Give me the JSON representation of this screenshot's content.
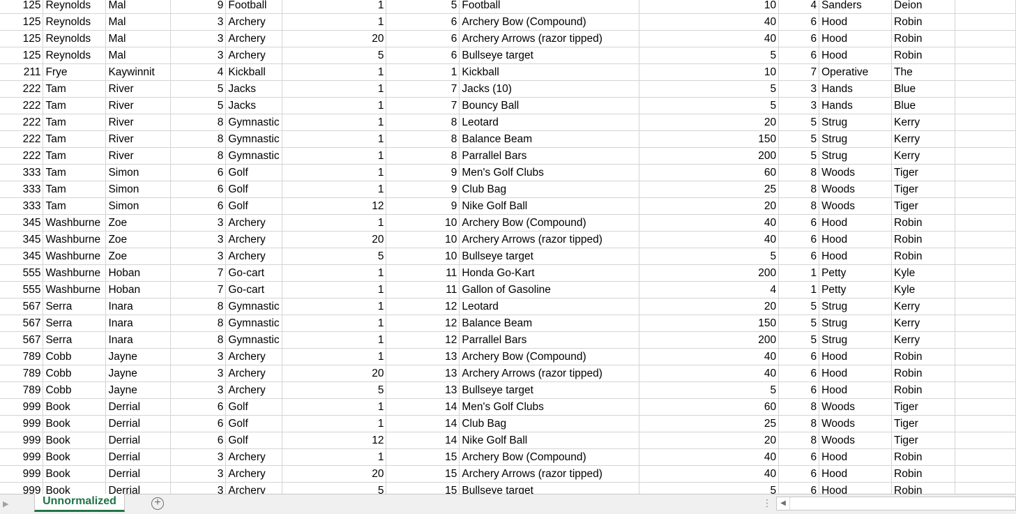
{
  "sheet_tab": "Unnormalized",
  "rows": [
    [
      "125",
      "Reynolds",
      "Mal",
      "9",
      "Football",
      "1",
      "5",
      "Football",
      "10",
      "4",
      "Sanders",
      "Deion"
    ],
    [
      "125",
      "Reynolds",
      "Mal",
      "3",
      "Archery",
      "1",
      "6",
      "Archery Bow (Compound)",
      "40",
      "6",
      "Hood",
      "Robin"
    ],
    [
      "125",
      "Reynolds",
      "Mal",
      "3",
      "Archery",
      "20",
      "6",
      "Archery Arrows (razor tipped)",
      "40",
      "6",
      "Hood",
      "Robin"
    ],
    [
      "125",
      "Reynolds",
      "Mal",
      "3",
      "Archery",
      "5",
      "6",
      "Bullseye target",
      "5",
      "6",
      "Hood",
      "Robin"
    ],
    [
      "211",
      "Frye",
      "Kaywinnit",
      "4",
      "Kickball",
      "1",
      "1",
      "Kickball",
      "10",
      "7",
      "Operative",
      "The"
    ],
    [
      "222",
      "Tam",
      "River",
      "5",
      "Jacks",
      "1",
      "7",
      "Jacks (10)",
      "5",
      "3",
      "Hands",
      "Blue"
    ],
    [
      "222",
      "Tam",
      "River",
      "5",
      "Jacks",
      "1",
      "7",
      "Bouncy Ball",
      "5",
      "3",
      "Hands",
      "Blue"
    ],
    [
      "222",
      "Tam",
      "River",
      "8",
      "Gymnastic",
      "1",
      "8",
      "Leotard",
      "20",
      "5",
      "Strug",
      "Kerry"
    ],
    [
      "222",
      "Tam",
      "River",
      "8",
      "Gymnastic",
      "1",
      "8",
      "Balance Beam",
      "150",
      "5",
      "Strug",
      "Kerry"
    ],
    [
      "222",
      "Tam",
      "River",
      "8",
      "Gymnastic",
      "1",
      "8",
      "Parrallel Bars",
      "200",
      "5",
      "Strug",
      "Kerry"
    ],
    [
      "333",
      "Tam",
      "Simon",
      "6",
      "Golf",
      "1",
      "9",
      "Men's Golf Clubs",
      "60",
      "8",
      "Woods",
      "Tiger"
    ],
    [
      "333",
      "Tam",
      "Simon",
      "6",
      "Golf",
      "1",
      "9",
      "Club Bag",
      "25",
      "8",
      "Woods",
      "Tiger"
    ],
    [
      "333",
      "Tam",
      "Simon",
      "6",
      "Golf",
      "12",
      "9",
      "Nike Golf Ball",
      "20",
      "8",
      "Woods",
      "Tiger"
    ],
    [
      "345",
      "Washburne",
      "Zoe",
      "3",
      "Archery",
      "1",
      "10",
      "Archery Bow (Compound)",
      "40",
      "6",
      "Hood",
      "Robin"
    ],
    [
      "345",
      "Washburne",
      "Zoe",
      "3",
      "Archery",
      "20",
      "10",
      "Archery Arrows (razor tipped)",
      "40",
      "6",
      "Hood",
      "Robin"
    ],
    [
      "345",
      "Washburne",
      "Zoe",
      "3",
      "Archery",
      "5",
      "10",
      "Bullseye target",
      "5",
      "6",
      "Hood",
      "Robin"
    ],
    [
      "555",
      "Washburne",
      "Hoban",
      "7",
      "Go-cart",
      "1",
      "11",
      "Honda Go-Kart",
      "200",
      "1",
      "Petty",
      "Kyle"
    ],
    [
      "555",
      "Washburne",
      "Hoban",
      "7",
      "Go-cart",
      "1",
      "11",
      "Gallon of Gasoline",
      "4",
      "1",
      "Petty",
      "Kyle"
    ],
    [
      "567",
      "Serra",
      "Inara",
      "8",
      "Gymnastic",
      "1",
      "12",
      "Leotard",
      "20",
      "5",
      "Strug",
      "Kerry"
    ],
    [
      "567",
      "Serra",
      "Inara",
      "8",
      "Gymnastic",
      "1",
      "12",
      "Balance Beam",
      "150",
      "5",
      "Strug",
      "Kerry"
    ],
    [
      "567",
      "Serra",
      "Inara",
      "8",
      "Gymnastic",
      "1",
      "12",
      "Parrallel Bars",
      "200",
      "5",
      "Strug",
      "Kerry"
    ],
    [
      "789",
      "Cobb",
      "Jayne",
      "3",
      "Archery",
      "1",
      "13",
      "Archery Bow (Compound)",
      "40",
      "6",
      "Hood",
      "Robin"
    ],
    [
      "789",
      "Cobb",
      "Jayne",
      "3",
      "Archery",
      "20",
      "13",
      "Archery Arrows (razor tipped)",
      "40",
      "6",
      "Hood",
      "Robin"
    ],
    [
      "789",
      "Cobb",
      "Jayne",
      "3",
      "Archery",
      "5",
      "13",
      "Bullseye target",
      "5",
      "6",
      "Hood",
      "Robin"
    ],
    [
      "999",
      "Book",
      "Derrial",
      "6",
      "Golf",
      "1",
      "14",
      "Men's Golf Clubs",
      "60",
      "8",
      "Woods",
      "Tiger"
    ],
    [
      "999",
      "Book",
      "Derrial",
      "6",
      "Golf",
      "1",
      "14",
      "Club Bag",
      "25",
      "8",
      "Woods",
      "Tiger"
    ],
    [
      "999",
      "Book",
      "Derrial",
      "6",
      "Golf",
      "12",
      "14",
      "Nike Golf Ball",
      "20",
      "8",
      "Woods",
      "Tiger"
    ],
    [
      "999",
      "Book",
      "Derrial",
      "3",
      "Archery",
      "1",
      "15",
      "Archery Bow (Compound)",
      "40",
      "6",
      "Hood",
      "Robin"
    ],
    [
      "999",
      "Book",
      "Derrial",
      "3",
      "Archery",
      "20",
      "15",
      "Archery Arrows (razor tipped)",
      "40",
      "6",
      "Hood",
      "Robin"
    ],
    [
      "999",
      "Book",
      "Derrial",
      "3",
      "Archery",
      "5",
      "15",
      "Bullseye target",
      "5",
      "6",
      "Hood",
      "Robin"
    ]
  ],
  "colors": {
    "accent": "#217346",
    "grid": "#d4d4d4",
    "tabbar": "#f0f0f0"
  },
  "icons": {
    "prev": "caret-right-icon",
    "add": "plus-circle-icon",
    "split": "vertical-dots-icon",
    "scroll_left": "caret-left-icon"
  }
}
